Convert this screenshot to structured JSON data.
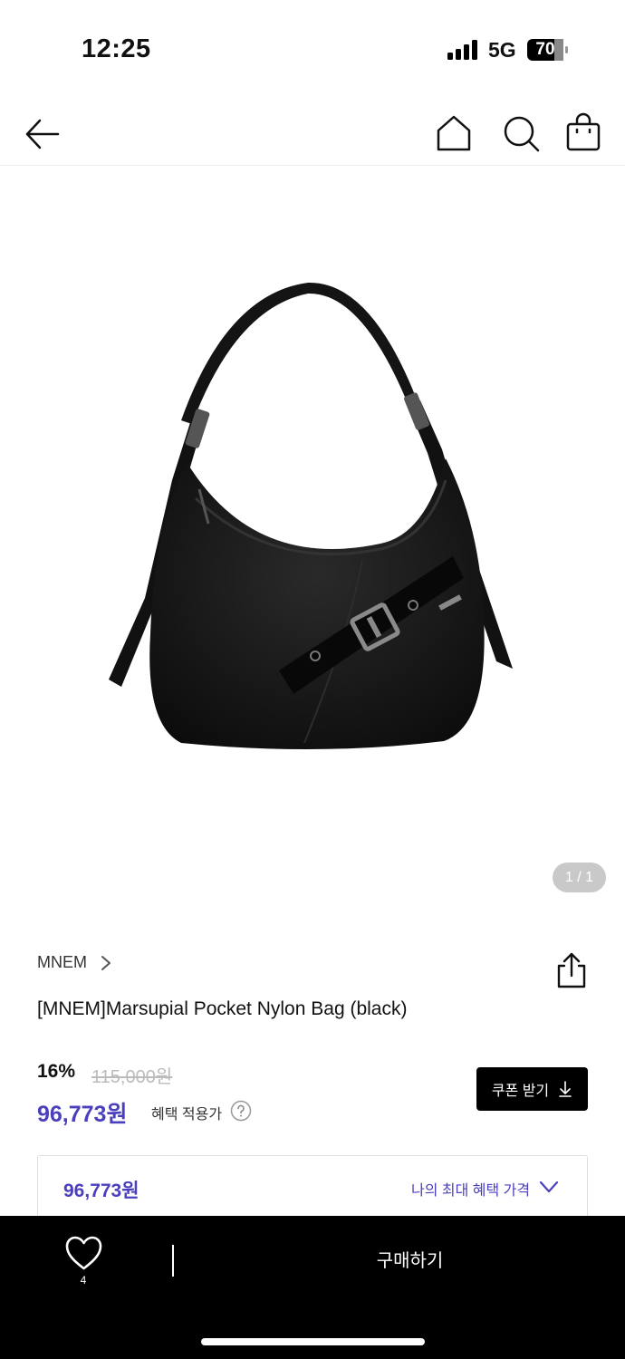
{
  "status_bar": {
    "time": "12:25",
    "network": "5G",
    "battery": "70"
  },
  "nav": {
    "back_icon": "arrow-left-icon",
    "home_icon": "home-icon",
    "search_icon": "search-icon",
    "bag_icon": "shopping-bag-icon"
  },
  "gallery": {
    "pager": "1 / 1"
  },
  "product": {
    "brand": "MNEM",
    "title": "[MNEM]Marsupial Pocket Nylon Bag (black)",
    "discount": "16%",
    "original_price": "115,000원",
    "sale_price": "96,773원",
    "benefit_label": "혜택 적용가",
    "coupon_label": "쿠폰 받기"
  },
  "max_benefit": {
    "price": "96,773원",
    "label": "나의 최대 혜택 가격"
  },
  "bottom_bar": {
    "wish_count": "4",
    "buy_label": "구매하기"
  },
  "colors": {
    "accent": "#4a3fbd",
    "bar": "#000000"
  }
}
